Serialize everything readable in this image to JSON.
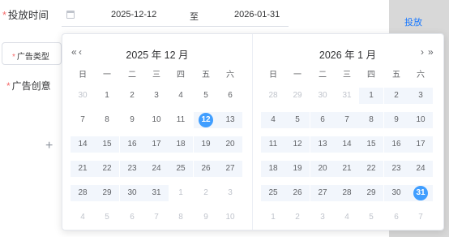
{
  "form": {
    "time_label": "投放时间",
    "type_label": "广告类型",
    "creative_label": "广告创意",
    "required_mark": "*"
  },
  "date_range": {
    "start": "2025-12-12",
    "separator": "至",
    "end": "2026-01-31"
  },
  "side": {
    "link_label": "投放"
  },
  "upload": {
    "plus": "+"
  },
  "colors": {
    "primary": "#409eff",
    "range_bg": "#f2f6fc",
    "required": "#f56c6c",
    "muted": "#c0c4cc"
  },
  "picker": {
    "weekdays": [
      "日",
      "一",
      "二",
      "三",
      "四",
      "五",
      "六"
    ],
    "nav": {
      "prev_year": "«",
      "prev_month": "‹",
      "next_month": "›",
      "next_year": "»"
    },
    "left": {
      "title": "2025 年 12 月",
      "days": [
        {
          "d": "30",
          "t": "prev"
        },
        {
          "d": "1",
          "t": "cur"
        },
        {
          "d": "2",
          "t": "cur"
        },
        {
          "d": "3",
          "t": "cur"
        },
        {
          "d": "4",
          "t": "cur"
        },
        {
          "d": "5",
          "t": "cur"
        },
        {
          "d": "6",
          "t": "cur"
        },
        {
          "d": "7",
          "t": "cur"
        },
        {
          "d": "8",
          "t": "cur"
        },
        {
          "d": "9",
          "t": "cur"
        },
        {
          "d": "10",
          "t": "cur"
        },
        {
          "d": "11",
          "t": "cur"
        },
        {
          "d": "12",
          "t": "cur",
          "sel": true
        },
        {
          "d": "13",
          "t": "cur",
          "range": true
        },
        {
          "d": "14",
          "t": "cur",
          "range": true
        },
        {
          "d": "15",
          "t": "cur",
          "range": true
        },
        {
          "d": "16",
          "t": "cur",
          "range": true
        },
        {
          "d": "17",
          "t": "cur",
          "range": true
        },
        {
          "d": "18",
          "t": "cur",
          "range": true
        },
        {
          "d": "19",
          "t": "cur",
          "range": true
        },
        {
          "d": "20",
          "t": "cur",
          "range": true
        },
        {
          "d": "21",
          "t": "cur",
          "range": true
        },
        {
          "d": "22",
          "t": "cur",
          "range": true
        },
        {
          "d": "23",
          "t": "cur",
          "range": true
        },
        {
          "d": "24",
          "t": "cur",
          "range": true
        },
        {
          "d": "25",
          "t": "cur",
          "range": true
        },
        {
          "d": "26",
          "t": "cur",
          "range": true
        },
        {
          "d": "27",
          "t": "cur",
          "range": true
        },
        {
          "d": "28",
          "t": "cur",
          "range": true
        },
        {
          "d": "29",
          "t": "cur",
          "range": true
        },
        {
          "d": "30",
          "t": "cur",
          "range": true
        },
        {
          "d": "31",
          "t": "cur",
          "range": true
        },
        {
          "d": "1",
          "t": "next"
        },
        {
          "d": "2",
          "t": "next"
        },
        {
          "d": "3",
          "t": "next"
        },
        {
          "d": "4",
          "t": "next"
        },
        {
          "d": "5",
          "t": "next"
        },
        {
          "d": "6",
          "t": "next"
        },
        {
          "d": "7",
          "t": "next"
        },
        {
          "d": "8",
          "t": "next"
        },
        {
          "d": "9",
          "t": "next"
        },
        {
          "d": "10",
          "t": "next"
        }
      ]
    },
    "right": {
      "title": "2026 年 1 月",
      "days": [
        {
          "d": "28",
          "t": "prev"
        },
        {
          "d": "29",
          "t": "prev"
        },
        {
          "d": "30",
          "t": "prev"
        },
        {
          "d": "31",
          "t": "prev"
        },
        {
          "d": "1",
          "t": "cur",
          "range": true
        },
        {
          "d": "2",
          "t": "cur",
          "range": true
        },
        {
          "d": "3",
          "t": "cur",
          "range": true
        },
        {
          "d": "4",
          "t": "cur",
          "range": true
        },
        {
          "d": "5",
          "t": "cur",
          "range": true
        },
        {
          "d": "6",
          "t": "cur",
          "range": true
        },
        {
          "d": "7",
          "t": "cur",
          "range": true
        },
        {
          "d": "8",
          "t": "cur",
          "range": true
        },
        {
          "d": "9",
          "t": "cur",
          "range": true
        },
        {
          "d": "10",
          "t": "cur",
          "range": true
        },
        {
          "d": "11",
          "t": "cur",
          "range": true
        },
        {
          "d": "12",
          "t": "cur",
          "range": true
        },
        {
          "d": "13",
          "t": "cur",
          "range": true
        },
        {
          "d": "14",
          "t": "cur",
          "range": true
        },
        {
          "d": "15",
          "t": "cur",
          "range": true
        },
        {
          "d": "16",
          "t": "cur",
          "range": true
        },
        {
          "d": "17",
          "t": "cur",
          "range": true
        },
        {
          "d": "18",
          "t": "cur",
          "range": true
        },
        {
          "d": "19",
          "t": "cur",
          "range": true
        },
        {
          "d": "20",
          "t": "cur",
          "range": true
        },
        {
          "d": "21",
          "t": "cur",
          "range": true
        },
        {
          "d": "22",
          "t": "cur",
          "range": true
        },
        {
          "d": "23",
          "t": "cur",
          "range": true
        },
        {
          "d": "24",
          "t": "cur",
          "range": true
        },
        {
          "d": "25",
          "t": "cur",
          "range": true
        },
        {
          "d": "26",
          "t": "cur",
          "range": true
        },
        {
          "d": "27",
          "t": "cur",
          "range": true
        },
        {
          "d": "28",
          "t": "cur",
          "range": true
        },
        {
          "d": "29",
          "t": "cur",
          "range": true
        },
        {
          "d": "30",
          "t": "cur",
          "range": true
        },
        {
          "d": "31",
          "t": "cur",
          "sel": true
        },
        {
          "d": "1",
          "t": "next"
        },
        {
          "d": "2",
          "t": "next"
        },
        {
          "d": "3",
          "t": "next"
        },
        {
          "d": "4",
          "t": "next"
        },
        {
          "d": "5",
          "t": "next"
        },
        {
          "d": "6",
          "t": "next"
        },
        {
          "d": "7",
          "t": "next"
        }
      ]
    }
  }
}
